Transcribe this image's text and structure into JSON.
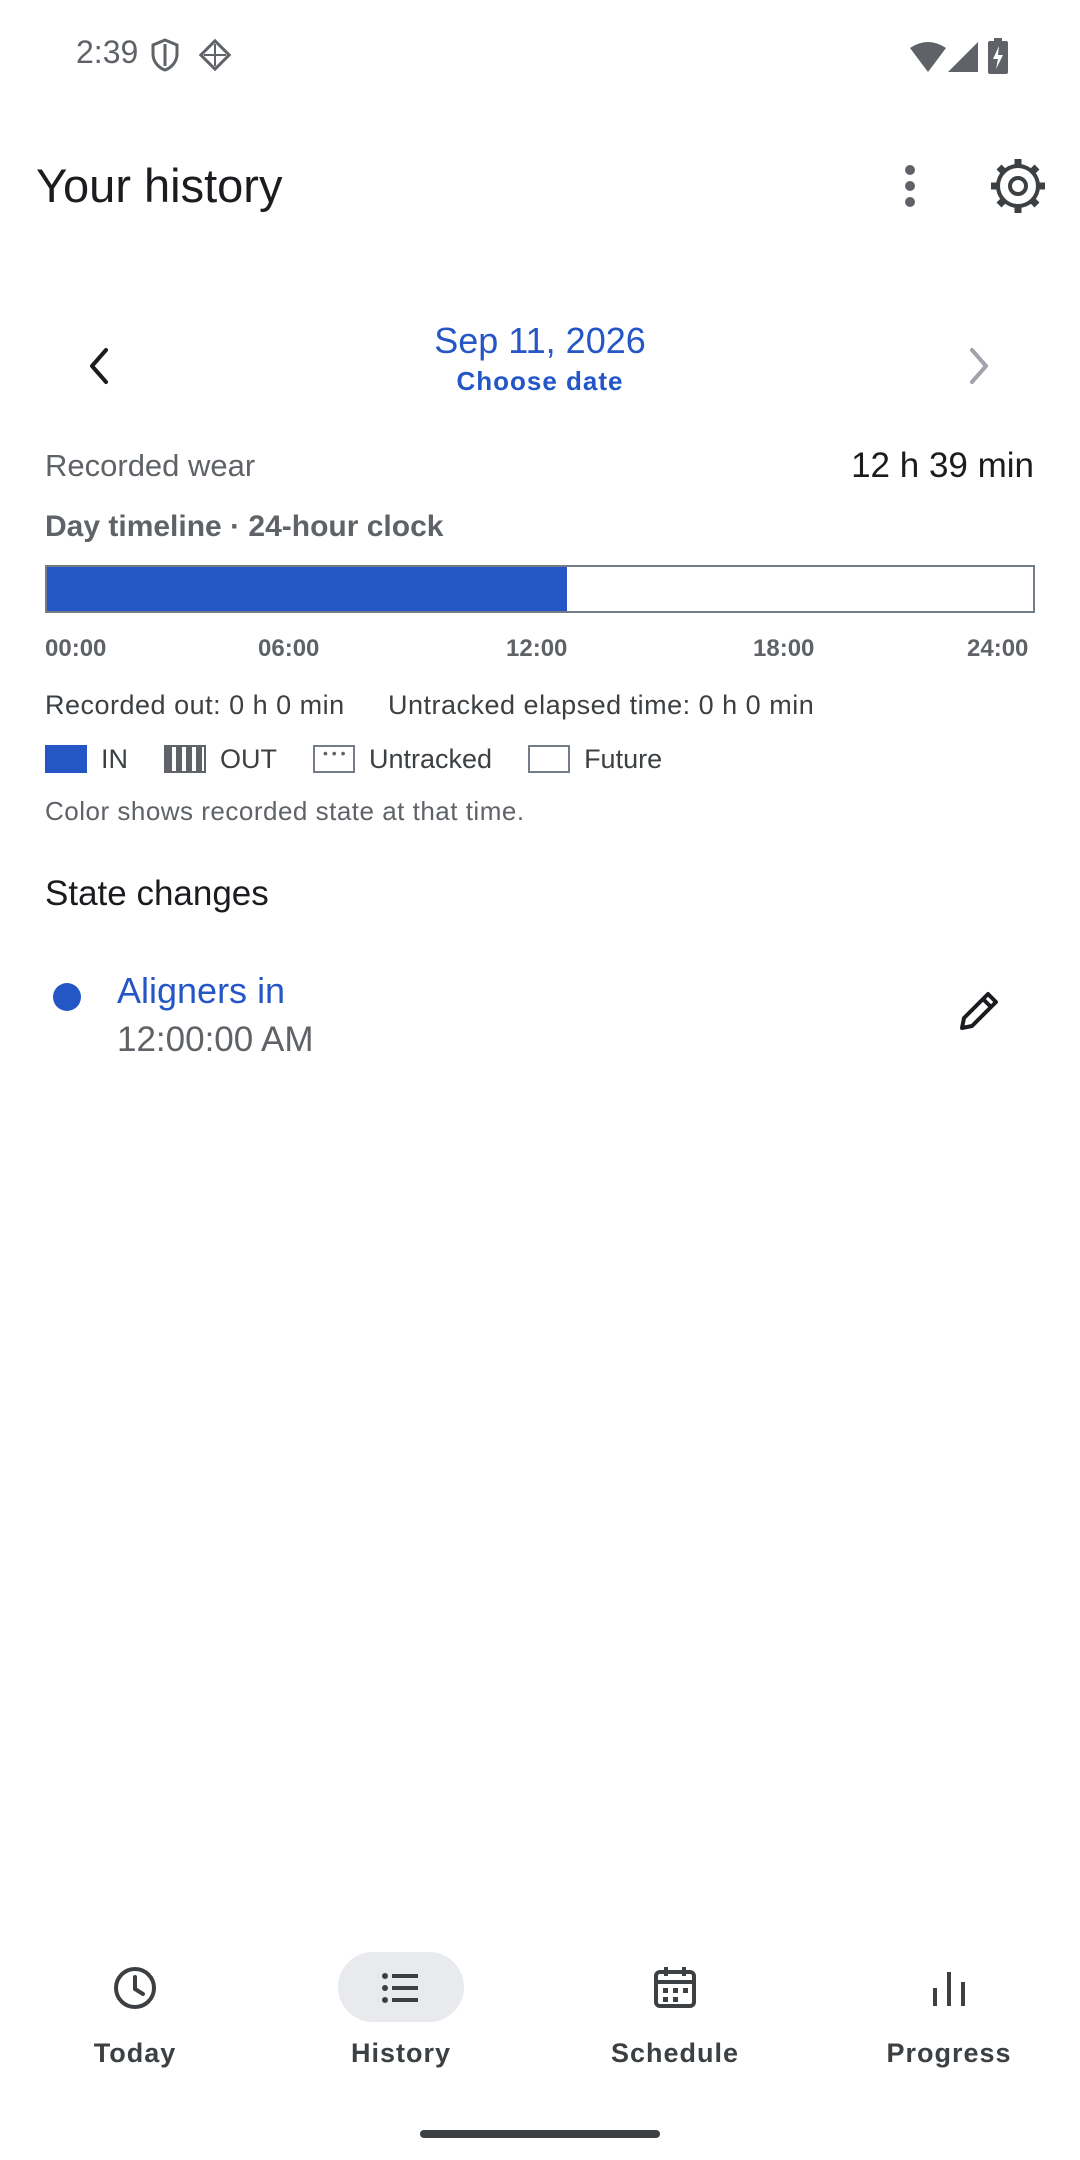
{
  "status_bar": {
    "time": "2:39",
    "icons": [
      "shield-icon",
      "diamond-grid-icon",
      "wifi-icon",
      "signal-icon",
      "battery-charging-icon"
    ]
  },
  "header": {
    "title": "Your history",
    "menu_icon": "more-vert-icon",
    "settings_icon": "gear-icon"
  },
  "date_nav": {
    "date": "Sep 11, 2026",
    "choose_label": "Choose date",
    "prev_icon": "chevron-left-icon",
    "next_icon": "chevron-right-icon"
  },
  "wear": {
    "label": "Recorded wear",
    "value": "12 h 39 min"
  },
  "timeline": {
    "title": "Day timeline · 24-hour clock",
    "in_fraction": 0.527,
    "ticks": [
      "00:00",
      "06:00",
      "12:00",
      "18:00",
      "24:00"
    ],
    "recorded_out": "Recorded out: 0 h 0 min",
    "untracked_elapsed": "Untracked elapsed time: 0 h 0 min",
    "colors": {
      "in": "#2457c5",
      "out": "#5f6368",
      "future": "#ffffff",
      "border": "#747c88"
    }
  },
  "legend": {
    "in": "IN",
    "out": "OUT",
    "untracked": "Untracked",
    "future": "Future",
    "note": "Color shows recorded state at that time."
  },
  "state_changes": {
    "title": "State changes",
    "items": [
      {
        "label": "Aligners in",
        "time": "12:00:00 AM",
        "edit_icon": "pencil-icon"
      }
    ]
  },
  "bottom_nav": {
    "active": "History",
    "items": [
      {
        "label": "Today",
        "icon": "clock-icon"
      },
      {
        "label": "History",
        "icon": "list-icon"
      },
      {
        "label": "Schedule",
        "icon": "calendar-icon"
      },
      {
        "label": "Progress",
        "icon": "bar-chart-icon"
      }
    ]
  }
}
